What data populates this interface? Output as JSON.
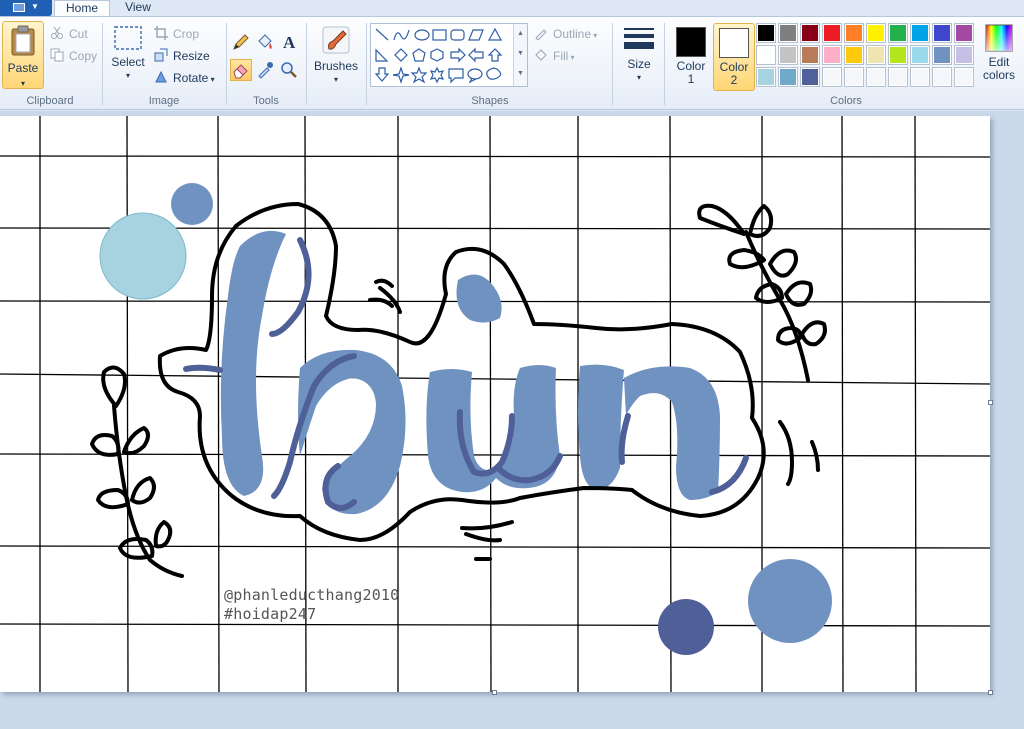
{
  "tabs": {
    "home": "Home",
    "view": "View"
  },
  "clipboard": {
    "label": "Clipboard",
    "paste": "Paste",
    "cut": "Cut",
    "copy": "Copy"
  },
  "image": {
    "label": "Image",
    "select": "Select",
    "crop": "Crop",
    "resize": "Resize",
    "rotate": "Rotate"
  },
  "tools": {
    "label": "Tools",
    "active_tool": "eraser"
  },
  "brushes": {
    "label": "Brushes"
  },
  "shapes": {
    "label": "Shapes",
    "outline": "Outline",
    "fill": "Fill"
  },
  "size": {
    "label": "Size"
  },
  "colors": {
    "label": "Colors",
    "color1_line1": "Color",
    "color1_line2": "1",
    "color2_line1": "Color",
    "color2_line2": "2",
    "edit_line1": "Edit",
    "edit_line2": "colors",
    "color1": "#000000",
    "color2": "#ffffff",
    "palette_row1": [
      "#000000",
      "#7f7f7f",
      "#880015",
      "#ed1c24",
      "#ff7f27",
      "#fff200",
      "#22b14c",
      "#00a2e8",
      "#3f48cc",
      "#a349a4"
    ],
    "palette_row2": [
      "#ffffff",
      "#c3c3c3",
      "#b97a57",
      "#ffaec9",
      "#ffc90e",
      "#efe4b0",
      "#b5e61d",
      "#99d9ea",
      "#7092be",
      "#c8bfe7"
    ],
    "palette_row3": [
      "#a7d3e0",
      "#6fa8c9",
      "#50609a"
    ]
  },
  "canvas": {
    "artwork": {
      "primary_blue": "#6f92c0",
      "dark_blue": "#4f5f98",
      "light_blue": "#a7d3e0",
      "outline": "#000000"
    },
    "watermark_line1": "@phanleducthang2010",
    "watermark_line2": "#hoidap247"
  }
}
